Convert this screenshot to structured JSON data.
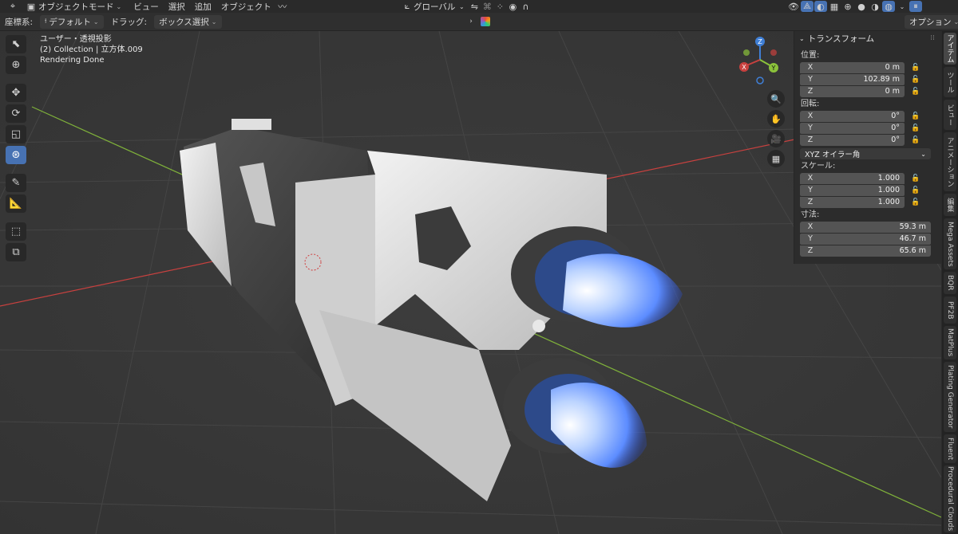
{
  "menubar": {
    "mode_label": "オブジェクトモード",
    "items": [
      "ビュー",
      "選択",
      "追加",
      "オブジェクト"
    ],
    "transform_orientation": "グローバル",
    "options_label": "オプション"
  },
  "header": {
    "coord_label": "座標系:",
    "coord_value": "デフォルト",
    "drag_label": "ドラッグ:",
    "drag_value": "ボックス選択"
  },
  "viewport_info": {
    "line1": "ユーザー・透視投影",
    "line2": "(2) Collection | 立方体.009",
    "line3": "Rendering Done"
  },
  "gizmo": {
    "x": "X",
    "y": "Y",
    "z": "Z"
  },
  "npanel": {
    "title": "トランスフォーム",
    "location_label": "位置:",
    "location": [
      {
        "axis": "X",
        "value": "0 m"
      },
      {
        "axis": "Y",
        "value": "102.89 m"
      },
      {
        "axis": "Z",
        "value": "0 m"
      }
    ],
    "rotation_label": "回転:",
    "rotation": [
      {
        "axis": "X",
        "value": "0°"
      },
      {
        "axis": "Y",
        "value": "0°"
      },
      {
        "axis": "Z",
        "value": "0°"
      }
    ],
    "rotation_mode": "XYZ オイラー角",
    "scale_label": "スケール:",
    "scale": [
      {
        "axis": "X",
        "value": "1.000"
      },
      {
        "axis": "Y",
        "value": "1.000"
      },
      {
        "axis": "Z",
        "value": "1.000"
      }
    ],
    "dimensions_label": "寸法:",
    "dimensions": [
      {
        "axis": "X",
        "value": "59.3 m"
      },
      {
        "axis": "Y",
        "value": "46.7 m"
      },
      {
        "axis": "Z",
        "value": "65.6 m"
      }
    ]
  },
  "side_tabs": [
    "アイテム",
    "ツール",
    "ビュー",
    "アニメーション",
    "編集",
    "Mega Assets",
    "BQR",
    "PF2B",
    "MatPlus",
    "Plating Generator",
    "Fluent",
    "Procedural Clouds"
  ],
  "colors": {
    "accent": "#4772b3",
    "axis_red": "#c8413f",
    "axis_green": "#8bc23b",
    "axis_blue": "#3f7fd6"
  }
}
